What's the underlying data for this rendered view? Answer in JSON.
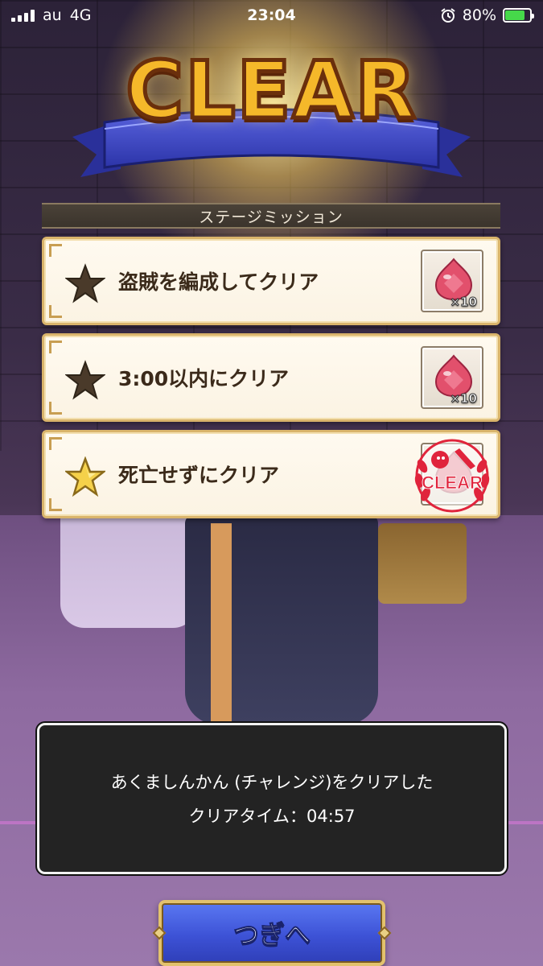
{
  "status_bar": {
    "carrier": "au",
    "network": "4G",
    "time": "23:04",
    "battery": "80%",
    "battery_level": 0.8,
    "accent": "#46d84a"
  },
  "banner": {
    "title": "CLEAR",
    "title_color": "#f5b82a",
    "ribbon_color": "#3e48c8"
  },
  "missions": {
    "header": "ステージミッション",
    "items": [
      {
        "text": "盗賊を編成してクリア",
        "achieved": false,
        "star_icon": "star-dark-icon",
        "reward_icon": "red-gem-icon",
        "reward_qty": "×10"
      },
      {
        "text": "3:00以内にクリア",
        "achieved": false,
        "star_icon": "star-dark-icon",
        "reward_icon": "red-gem-icon",
        "reward_qty": "×10"
      },
      {
        "text": "死亡せずにクリア",
        "achieved": true,
        "star_icon": "star-gold-icon",
        "reward_icon": "red-gem-icon",
        "stamp_label": "CLEAR"
      }
    ]
  },
  "result": {
    "line1": "あくましんかん (チャレンジ)をクリアした",
    "line2": "クリアタイム：04:57"
  },
  "next_button": {
    "label": "つぎへ"
  }
}
